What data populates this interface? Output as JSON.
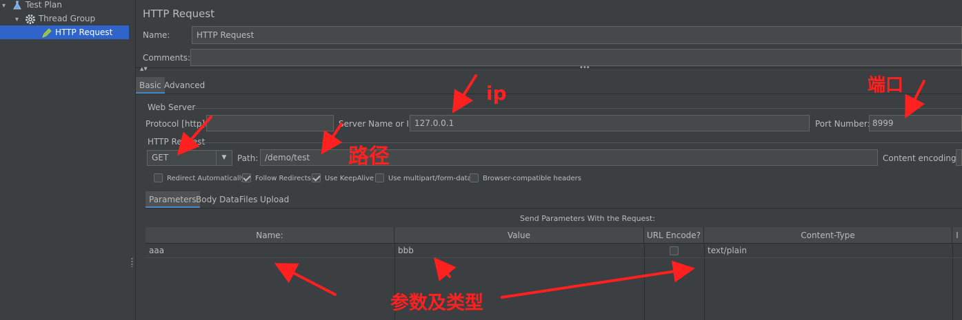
{
  "tree": {
    "items": [
      {
        "label": "Test Plan",
        "icon": "flask-icon"
      },
      {
        "label": "Thread Group",
        "icon": "gear-icon"
      },
      {
        "label": "HTTP Request",
        "icon": "pencil-icon"
      }
    ]
  },
  "panel": {
    "title": "HTTP Request",
    "name_label": "Name:",
    "name_value": "HTTP Request",
    "comments_label": "Comments:",
    "comments_value": ""
  },
  "tabs": [
    "Basic",
    "Advanced"
  ],
  "web_server": {
    "section_title": "Web Server",
    "protocol_label": "Protocol [http]:",
    "protocol_value": "",
    "server_label": "Server Name or IP:",
    "server_value": "127.0.0.1",
    "port_label": "Port Number:",
    "port_value": "8999"
  },
  "http_request": {
    "section_title": "HTTP Request",
    "method_value": "GET",
    "path_label": "Path:",
    "path_value": "/demo/test",
    "encoding_label": "Content encoding:"
  },
  "options": [
    {
      "label": "Redirect Automatically",
      "checked": false
    },
    {
      "label": "Follow Redirects",
      "checked": true
    },
    {
      "label": "Use KeepAlive",
      "checked": true
    },
    {
      "label": "Use multipart/form-data",
      "checked": false
    },
    {
      "label": "Browser-compatible headers",
      "checked": false
    }
  ],
  "subtabs": [
    "Parameters",
    "Body Data",
    "Files Upload"
  ],
  "params": {
    "caption": "Send Parameters With the Request:",
    "headers": [
      "Name:",
      "Value",
      "URL Encode?",
      "Content-Type",
      "I"
    ],
    "rows": [
      {
        "name": "aaa",
        "value": "bbb",
        "url_encode": false,
        "content_type": "text/plain"
      }
    ]
  },
  "annotations": {
    "ip": "ip",
    "port": "端口",
    "path": "路径",
    "params": "参数及类型"
  },
  "colors": {
    "background": "#3c3f41",
    "selection": "#2f65ca",
    "annotation": "#ff2020",
    "accent_tab": "#4a88c7"
  }
}
